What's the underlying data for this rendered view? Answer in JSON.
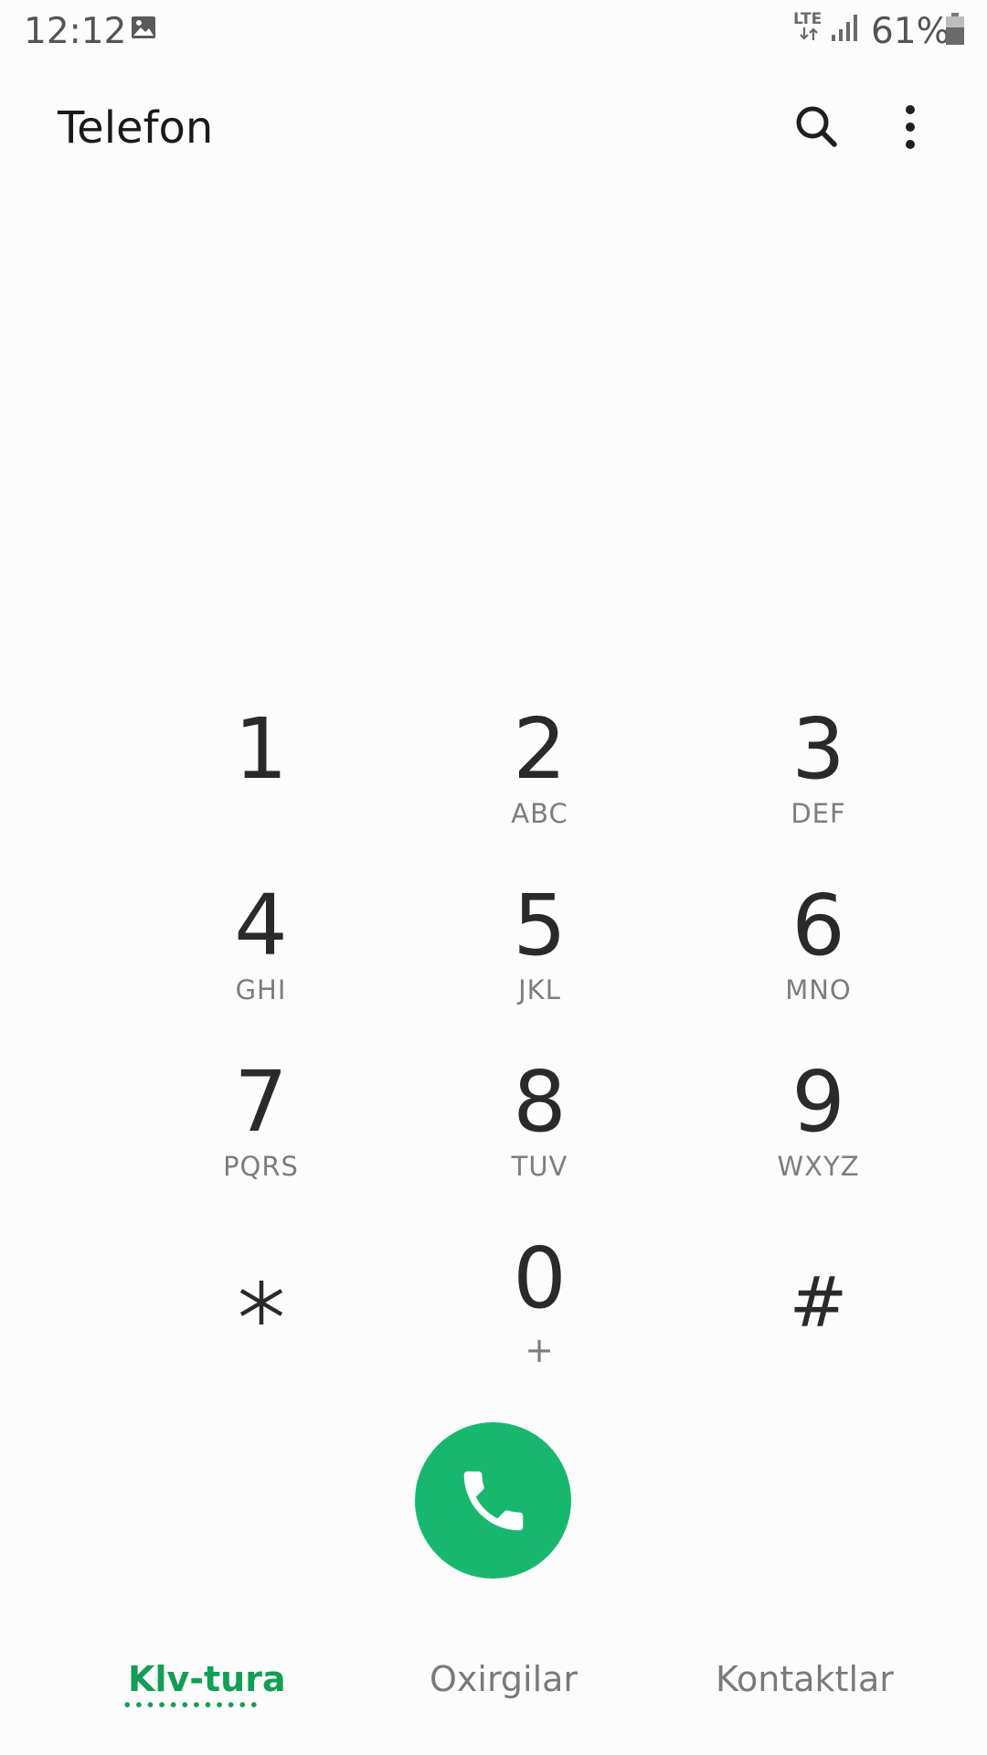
{
  "status_bar": {
    "time": "12:12",
    "network": "LTE",
    "battery_percent": "61%",
    "battery_level": 0.61
  },
  "header": {
    "title": "Telefon",
    "search_icon": "search-icon",
    "more_icon": "more-vert-icon"
  },
  "keypad": {
    "keys": [
      {
        "digit": "1",
        "letters": ""
      },
      {
        "digit": "2",
        "letters": "ABC"
      },
      {
        "digit": "3",
        "letters": "DEF"
      },
      {
        "digit": "4",
        "letters": "GHI"
      },
      {
        "digit": "5",
        "letters": "JKL"
      },
      {
        "digit": "6",
        "letters": "MNO"
      },
      {
        "digit": "7",
        "letters": "PQRS"
      },
      {
        "digit": "8",
        "letters": "TUV"
      },
      {
        "digit": "9",
        "letters": "WXYZ"
      },
      {
        "digit": "",
        "letters": "",
        "icon": "asterisk-icon"
      },
      {
        "digit": "0",
        "letters": "+"
      },
      {
        "digit": "#",
        "letters": ""
      }
    ]
  },
  "call_button": {
    "icon": "phone-icon",
    "color": "#17b86d"
  },
  "tabs": [
    {
      "label": "Klv-tura",
      "active": true
    },
    {
      "label": "Oxirgilar",
      "active": false
    },
    {
      "label": "Kontaktlar",
      "active": false
    }
  ],
  "colors": {
    "accent": "#129e55",
    "call": "#17b86d",
    "text_primary": "#2a2a2a",
    "text_secondary": "#7d7d7d"
  }
}
